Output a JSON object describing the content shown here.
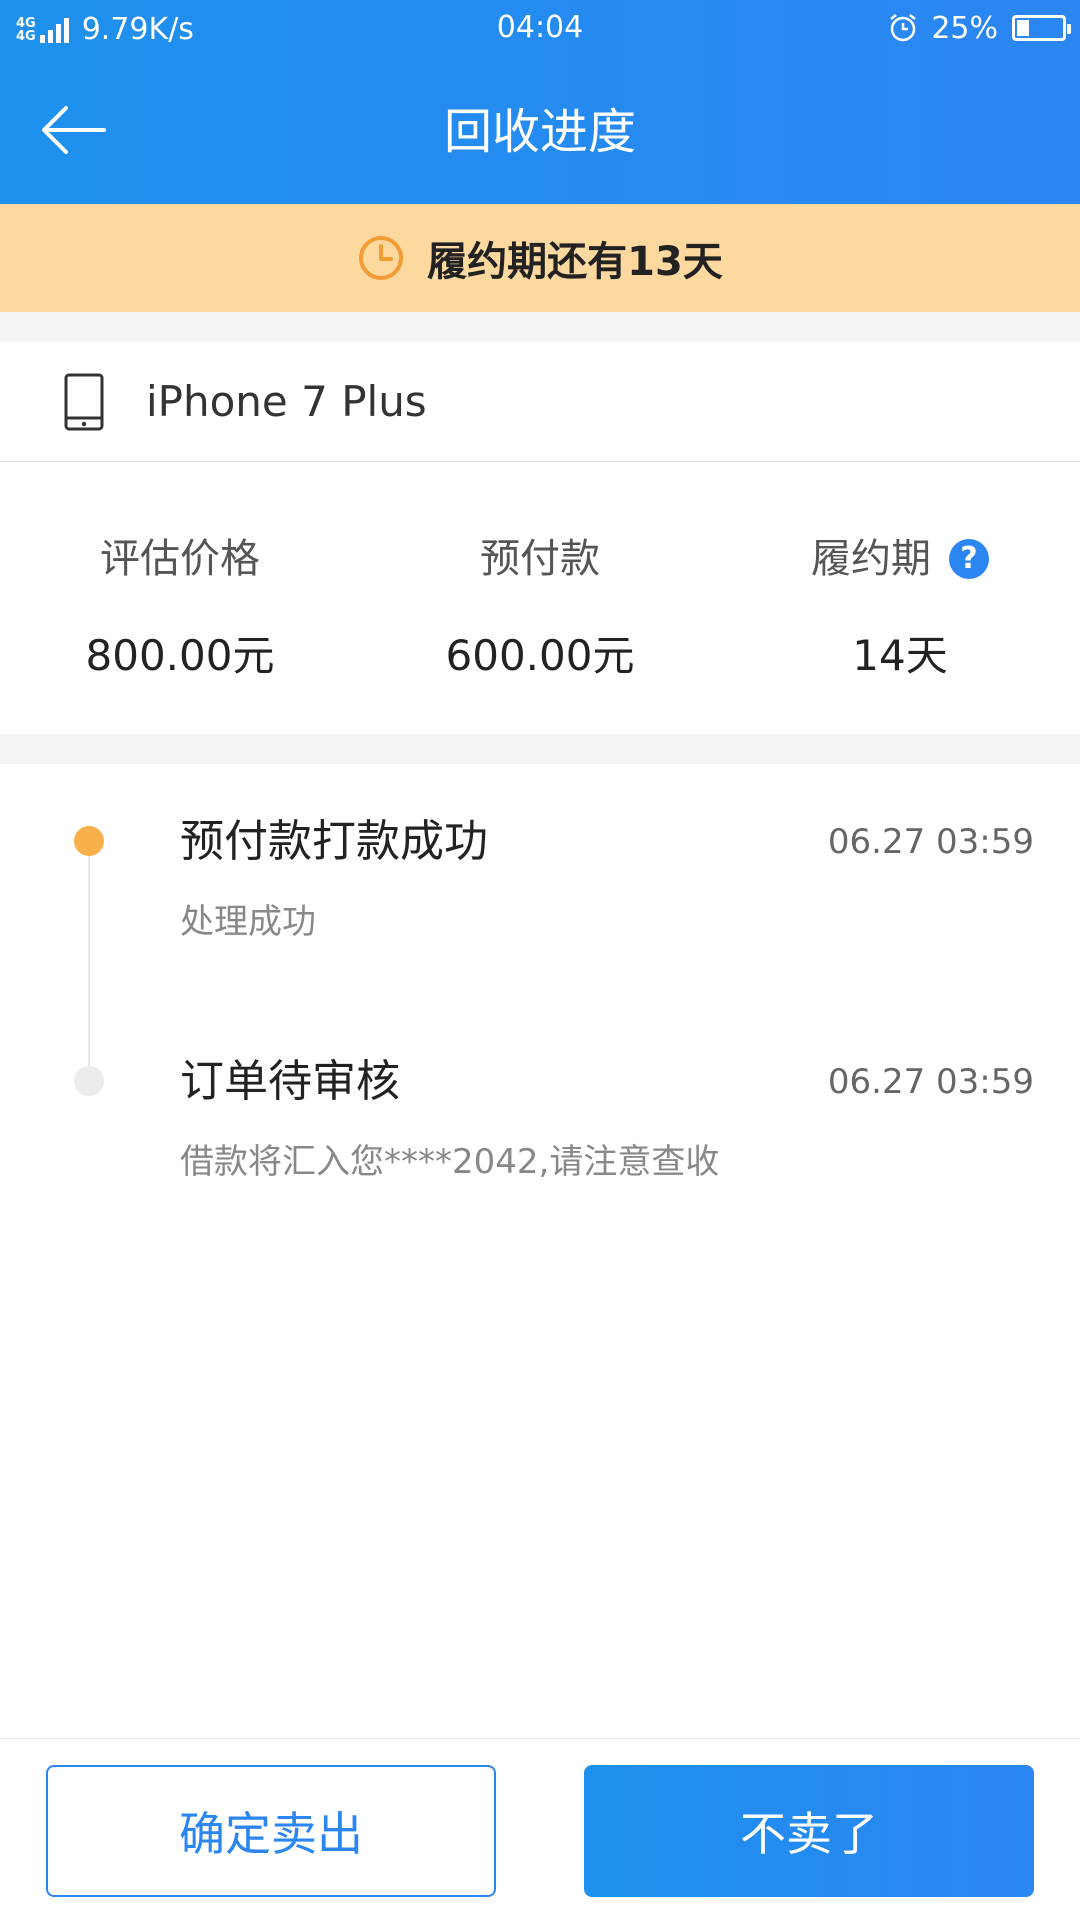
{
  "status_bar": {
    "network_type_1": "4G",
    "network_type_2": "4G",
    "net_speed": "9.79K/s",
    "time": "04:04",
    "battery_percent": "25%",
    "battery_level": 0.25
  },
  "nav": {
    "title": "回收进度"
  },
  "banner": {
    "text": "履约期还有13天",
    "background_color": "#fdd9a0",
    "icon_color": "#f39c34"
  },
  "device": {
    "name": "iPhone 7 Plus"
  },
  "summary": [
    {
      "label": "评估价格",
      "value": "800.00元"
    },
    {
      "label": "预付款",
      "value": "600.00元"
    },
    {
      "label": "履约期",
      "value": "14天",
      "help_icon": "?"
    }
  ],
  "timeline": [
    {
      "title": "预付款打款成功",
      "time": "06.27 03:59",
      "desc": "处理成功",
      "dot_color": "#f7b04a"
    },
    {
      "title": "订单待审核",
      "time": "06.27 03:59",
      "desc": "借款将汇入您****2042,请注意查收",
      "dot_color": "#ebebeb"
    }
  ],
  "buttons": {
    "confirm_sell": "确定卖出",
    "cancel_sell": "不卖了"
  },
  "colors": {
    "primary": "#2b86f2",
    "header_gradient_start": "#1e90ee"
  }
}
